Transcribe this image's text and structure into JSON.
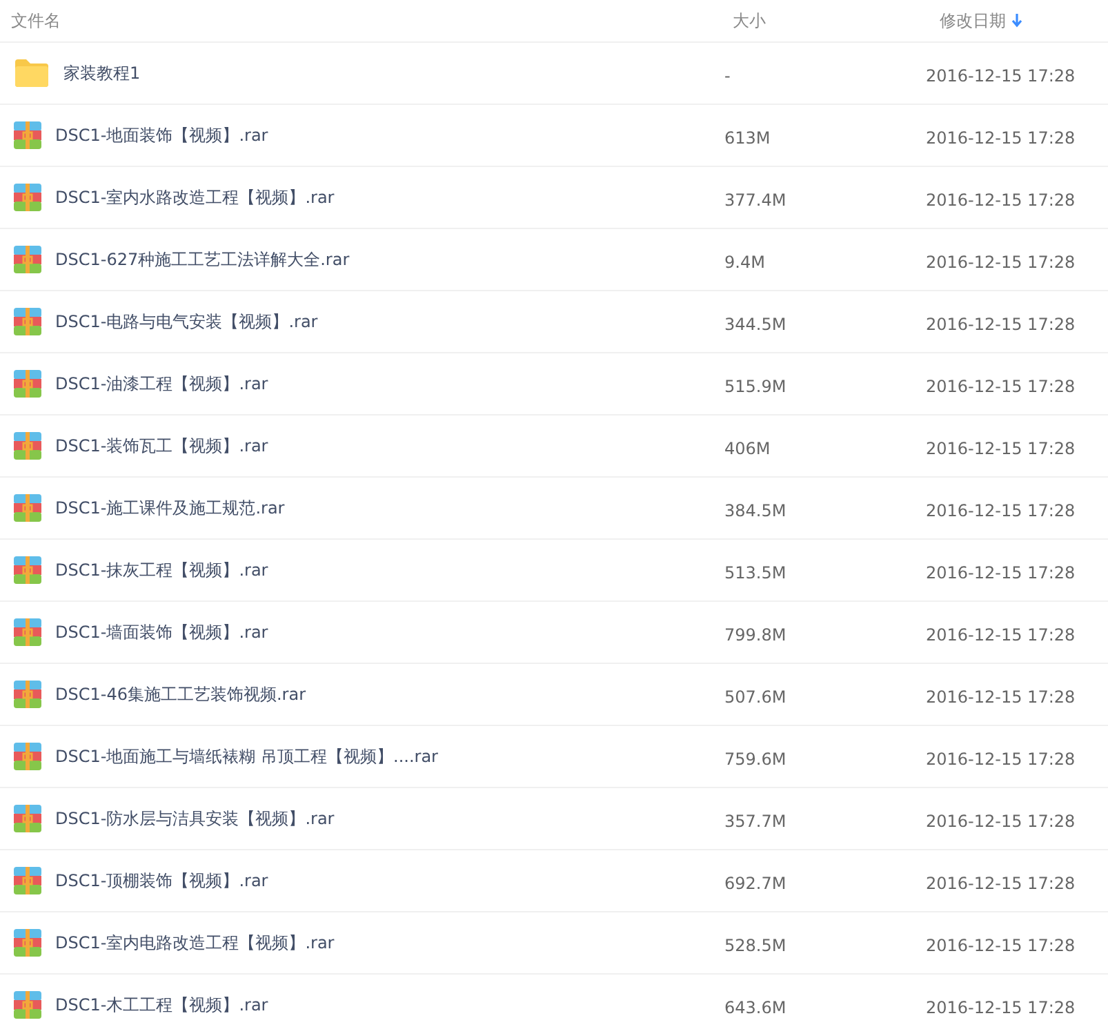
{
  "columns": [
    {
      "label": "文件名",
      "sorted": false
    },
    {
      "label": "大小",
      "sorted": false
    },
    {
      "label": "修改日期",
      "sorted": true
    }
  ],
  "rows": [
    {
      "kind": "folder",
      "name": "家装教程1",
      "size": "-",
      "date": "2016-12-15 17:28"
    },
    {
      "kind": "archive",
      "name": "DSC1-地面装饰【视频】.rar",
      "size": "613M",
      "date": "2016-12-15 17:28"
    },
    {
      "kind": "archive",
      "name": "DSC1-室内水路改造工程【视频】.rar",
      "size": "377.4M",
      "date": "2016-12-15 17:28"
    },
    {
      "kind": "archive",
      "name": "DSC1-627种施工工艺工法详解大全.rar",
      "size": "9.4M",
      "date": "2016-12-15 17:28"
    },
    {
      "kind": "archive",
      "name": "DSC1-电路与电气安装【视频】.rar",
      "size": "344.5M",
      "date": "2016-12-15 17:28"
    },
    {
      "kind": "archive",
      "name": "DSC1-油漆工程【视频】.rar",
      "size": "515.9M",
      "date": "2016-12-15 17:28"
    },
    {
      "kind": "archive",
      "name": "DSC1-装饰瓦工【视频】.rar",
      "size": "406M",
      "date": "2016-12-15 17:28"
    },
    {
      "kind": "archive",
      "name": "DSC1-施工课件及施工规范.rar",
      "size": "384.5M",
      "date": "2016-12-15 17:28"
    },
    {
      "kind": "archive",
      "name": "DSC1-抹灰工程【视频】.rar",
      "size": "513.5M",
      "date": "2016-12-15 17:28"
    },
    {
      "kind": "archive",
      "name": "DSC1-墙面装饰【视频】.rar",
      "size": "799.8M",
      "date": "2016-12-15 17:28"
    },
    {
      "kind": "archive",
      "name": "DSC1-46集施工工艺装饰视频.rar",
      "size": "507.6M",
      "date": "2016-12-15 17:28"
    },
    {
      "kind": "archive",
      "name": "DSC1-地面施工与墙纸裱糊 吊顶工程【视频】....rar",
      "size": "759.6M",
      "date": "2016-12-15 17:28"
    },
    {
      "kind": "archive",
      "name": "DSC1-防水层与洁具安装【视频】.rar",
      "size": "357.7M",
      "date": "2016-12-15 17:28"
    },
    {
      "kind": "archive",
      "name": "DSC1-顶棚装饰【视频】.rar",
      "size": "692.7M",
      "date": "2016-12-15 17:28"
    },
    {
      "kind": "archive",
      "name": "DSC1-室内电路改造工程【视频】.rar",
      "size": "528.5M",
      "date": "2016-12-15 17:28"
    },
    {
      "kind": "archive",
      "name": "DSC1-木工工程【视频】.rar",
      "size": "643.6M",
      "date": "2016-12-15 17:28"
    }
  ]
}
